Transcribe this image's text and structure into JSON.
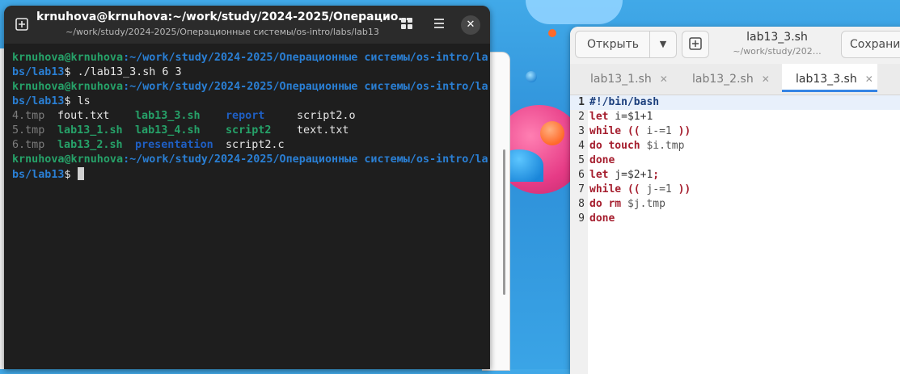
{
  "terminal": {
    "title": "krnuhova@krnuhova:~/work/study/2024-2025/Операцио…",
    "subtitle": "~/work/study/2024-2025/Операционные системы/os-intro/labs/lab13",
    "icons": [
      "new-tab-icon",
      "grid-view-icon",
      "menu-icon",
      "close-icon"
    ],
    "prompt_a": "krnuhova@krnuhova",
    "prompt_b": ":~/work/study/2024-2025/Операционные системы/os-intro/la",
    "prompt_c": "bs/lab13",
    "dollar": "$",
    "cmd1": " ./lab13_3.sh 6 3",
    "cmd2": " ls",
    "ls_rows": [
      [
        "4.tmp",
        "fout.txt",
        "lab13_3.sh",
        "report",
        "script2.o"
      ],
      [
        "5.tmp",
        "lab13_1.sh",
        "lab13_4.sh",
        "script2",
        "text.txt"
      ],
      [
        "6.tmp",
        "lab13_2.sh",
        "presentation",
        "script2.c",
        ""
      ]
    ]
  },
  "editor": {
    "open_label": "Открыть",
    "title": "lab13_3.sh",
    "subtitle": "~/work/study/202…",
    "save_label": "Сохранить",
    "tabs": [
      {
        "label": "lab13_1.sh"
      },
      {
        "label": "lab13_2.sh"
      },
      {
        "label": "lab13_3.sh"
      }
    ],
    "lines": {
      "l1": {
        "n": "1",
        "a": "#!/bin/bash"
      },
      "l2": {
        "n": "2",
        "kw": "let",
        "rest": " i=$1+1"
      },
      "l3": {
        "n": "3",
        "kw": "while",
        "b": " ((",
        "rest": " i-=1 ",
        "c": "))"
      },
      "l4": {
        "n": "4",
        "kw": "do",
        "kw2": " touch",
        "rest": " $i.tmp"
      },
      "l5": {
        "n": "5",
        "kw": "done"
      },
      "l6": {
        "n": "6",
        "kw": "let",
        "rest": " j=$2+1",
        "c": ";"
      },
      "l7": {
        "n": "7",
        "kw": "while",
        "b": " ((",
        "rest": " j-=1 ",
        "c": "))"
      },
      "l8": {
        "n": "8",
        "kw": "do",
        "kw2": " rm",
        "rest": " $j.tmp"
      },
      "l9": {
        "n": "9",
        "kw": "done"
      }
    }
  }
}
